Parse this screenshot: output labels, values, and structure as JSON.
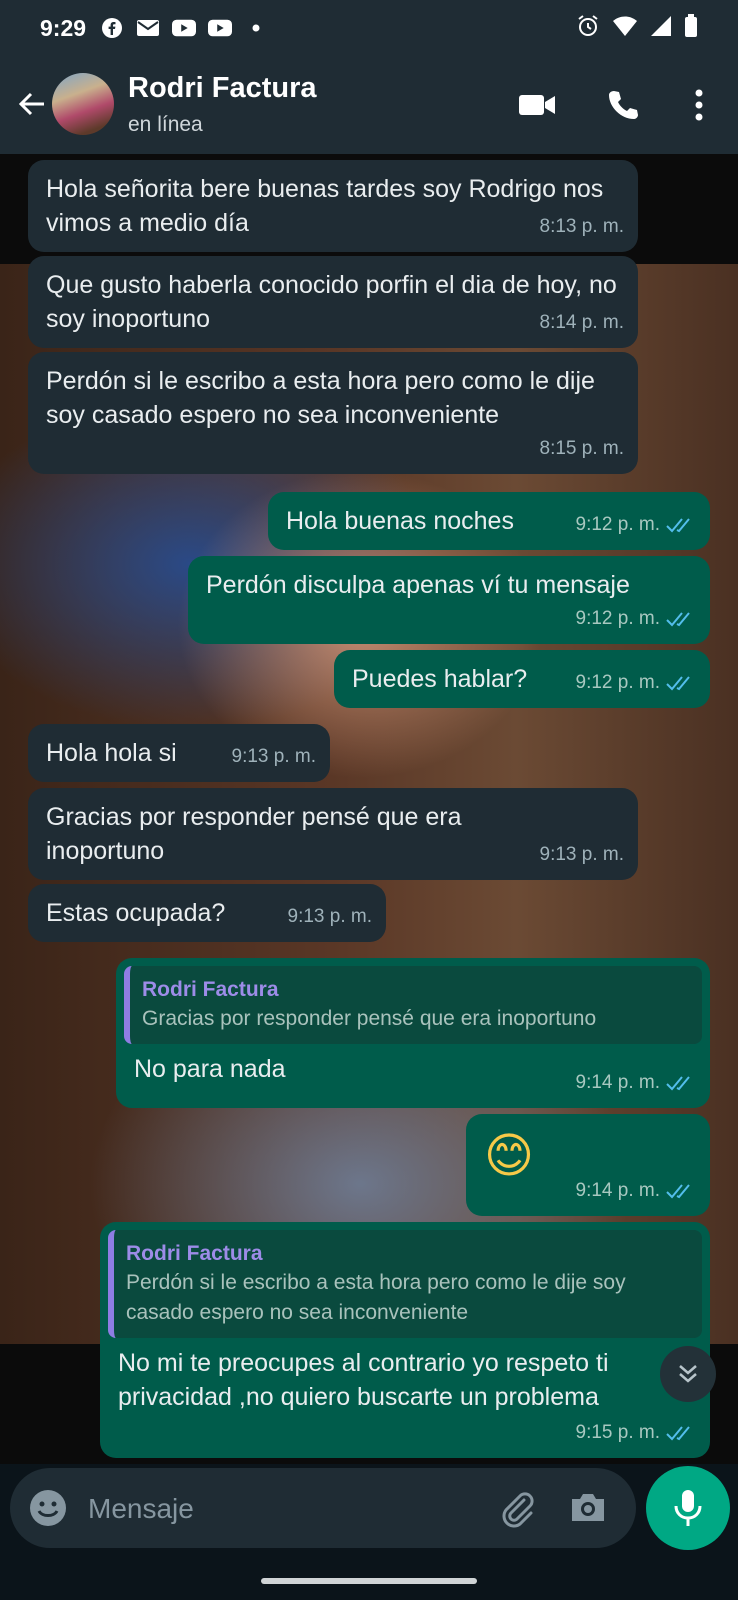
{
  "status_bar": {
    "time": "9:29"
  },
  "header": {
    "contact_name": "Rodri Factura",
    "contact_status": "en línea"
  },
  "messages": [
    {
      "dir": "in",
      "text": "Hola señorita bere buenas tardes soy Rodrigo nos vimos a medio día",
      "time": "8:13 p. m."
    },
    {
      "dir": "in",
      "text": "Que gusto haberla conocido porfin el dia de hoy, no soy inoportuno",
      "time": "8:14 p. m."
    },
    {
      "dir": "in",
      "text": "Perdón si le escribo a esta hora pero como le dije soy casado espero no sea inconveniente",
      "time": "8:15 p. m."
    },
    {
      "dir": "out",
      "text": "Hola buenas noches",
      "time": "9:12 p. m."
    },
    {
      "dir": "out",
      "text": "Perdón disculpa apenas ví tu mensaje",
      "time": "9:12 p. m."
    },
    {
      "dir": "out",
      "text": "Puedes hablar?",
      "time": "9:12 p. m."
    },
    {
      "dir": "in",
      "text": "Hola hola si",
      "time": "9:13 p. m."
    },
    {
      "dir": "in",
      "text": "Gracias por responder pensé que era inoportuno",
      "time": "9:13 p. m."
    },
    {
      "dir": "in",
      "text": "Estas ocupada?",
      "time": "9:13 p. m."
    },
    {
      "dir": "out",
      "quote_author": "Rodri Factura",
      "quote_text": "Gracias por responder pensé que era inoportuno",
      "text": "No para nada",
      "time": "9:14 p. m."
    },
    {
      "dir": "out",
      "text": "😊",
      "time": "9:14 p. m."
    },
    {
      "dir": "out",
      "quote_author": "Rodri Factura",
      "quote_text": "Perdón si le escribo a esta hora pero como le dije soy casado espero no sea inconveniente",
      "text": "No mi te preocupes al contrario yo respeto ti privacidad ,no quiero buscarte un problema",
      "time": "9:15 p. m."
    }
  ],
  "input": {
    "placeholder": "Mensaje"
  },
  "colors": {
    "incoming_bubble": "#1f2c34",
    "outgoing_bubble": "#005c4b",
    "accent": "#00a884",
    "read_ticks": "#53bdeb"
  }
}
